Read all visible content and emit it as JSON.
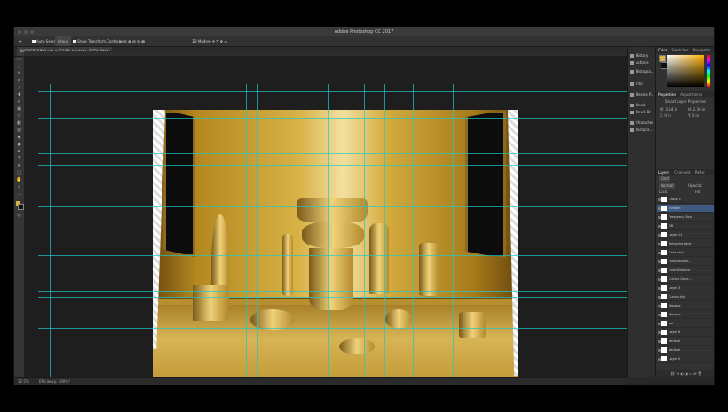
{
  "app": {
    "title": "Adobe Photoshop CC 2017"
  },
  "options_bar": {
    "auto_select": "Auto-Select:",
    "auto_select_value": "Group",
    "transform_controls": "Show Transform Controls",
    "mode_3d": "3D Mode:"
  },
  "document": {
    "tab": "BACKGROUND.psb @ 12.5% (metajte, RGB/16*) *"
  },
  "status": {
    "zoom": "12.5%",
    "info": "Efficiency: 100%*"
  },
  "panel_icons": [
    {
      "label": "History",
      "icon": "history-icon"
    },
    {
      "label": "Actions",
      "icon": "actions-icon"
    },
    {
      "label": "Histogra...",
      "icon": "histogram-icon"
    },
    {
      "label": "Info",
      "icon": "info-icon"
    },
    {
      "label": "Device P...",
      "icon": "device-preview-icon"
    },
    {
      "label": "Brush",
      "icon": "brush-icon"
    },
    {
      "label": "Brush Pr...",
      "icon": "brush-presets-icon"
    },
    {
      "label": "Character",
      "icon": "character-icon"
    },
    {
      "label": "Paragra...",
      "icon": "paragraph-icon"
    }
  ],
  "color_panel": {
    "tabs": [
      "Color",
      "Swatches",
      "Navigator"
    ],
    "foreground": "#d9b24a",
    "background": "#111111"
  },
  "properties_panel": {
    "tabs": [
      "Properties",
      "Adjustments"
    ],
    "type": "Smart Layer Properties",
    "w": "W: 3.34 in",
    "h": "H: 2.39 in",
    "x": "X: 0 in",
    "y": "Y: 0 in"
  },
  "layers_panel": {
    "tabs": [
      "Layers",
      "Channels",
      "Paths"
    ],
    "kind": "Kind",
    "blend": "Normal",
    "opacity": "Opacity:",
    "fill": "Fill:",
    "lock": "Lock:",
    "layers": [
      {
        "name": "Group 1",
        "selected": false
      },
      {
        "name": "metajte",
        "selected": true
      },
      {
        "name": "Frequency Sep",
        "selected": false
      },
      {
        "name": "DB",
        "selected": false
      },
      {
        "name": "Layer 11",
        "selected": false
      },
      {
        "name": "Retouche tone",
        "selected": false
      },
      {
        "name": "Gold paint",
        "selected": false
      },
      {
        "name": "Hue/Saturati...",
        "selected": false
      },
      {
        "name": "Color Balance 1",
        "selected": false
      },
      {
        "name": "Curves Gene...",
        "selected": false
      },
      {
        "name": "Layer 3",
        "selected": false
      },
      {
        "name": "Curves big",
        "selected": false
      },
      {
        "name": "Masque",
        "selected": false
      },
      {
        "name": "Masque",
        "selected": false
      },
      {
        "name": "sol",
        "selected": false
      },
      {
        "name": "Layer 6",
        "selected": false
      },
      {
        "name": "Vertical",
        "selected": false
      },
      {
        "name": "Vertical",
        "selected": false
      },
      {
        "name": "Layer 0",
        "selected": false
      }
    ]
  }
}
